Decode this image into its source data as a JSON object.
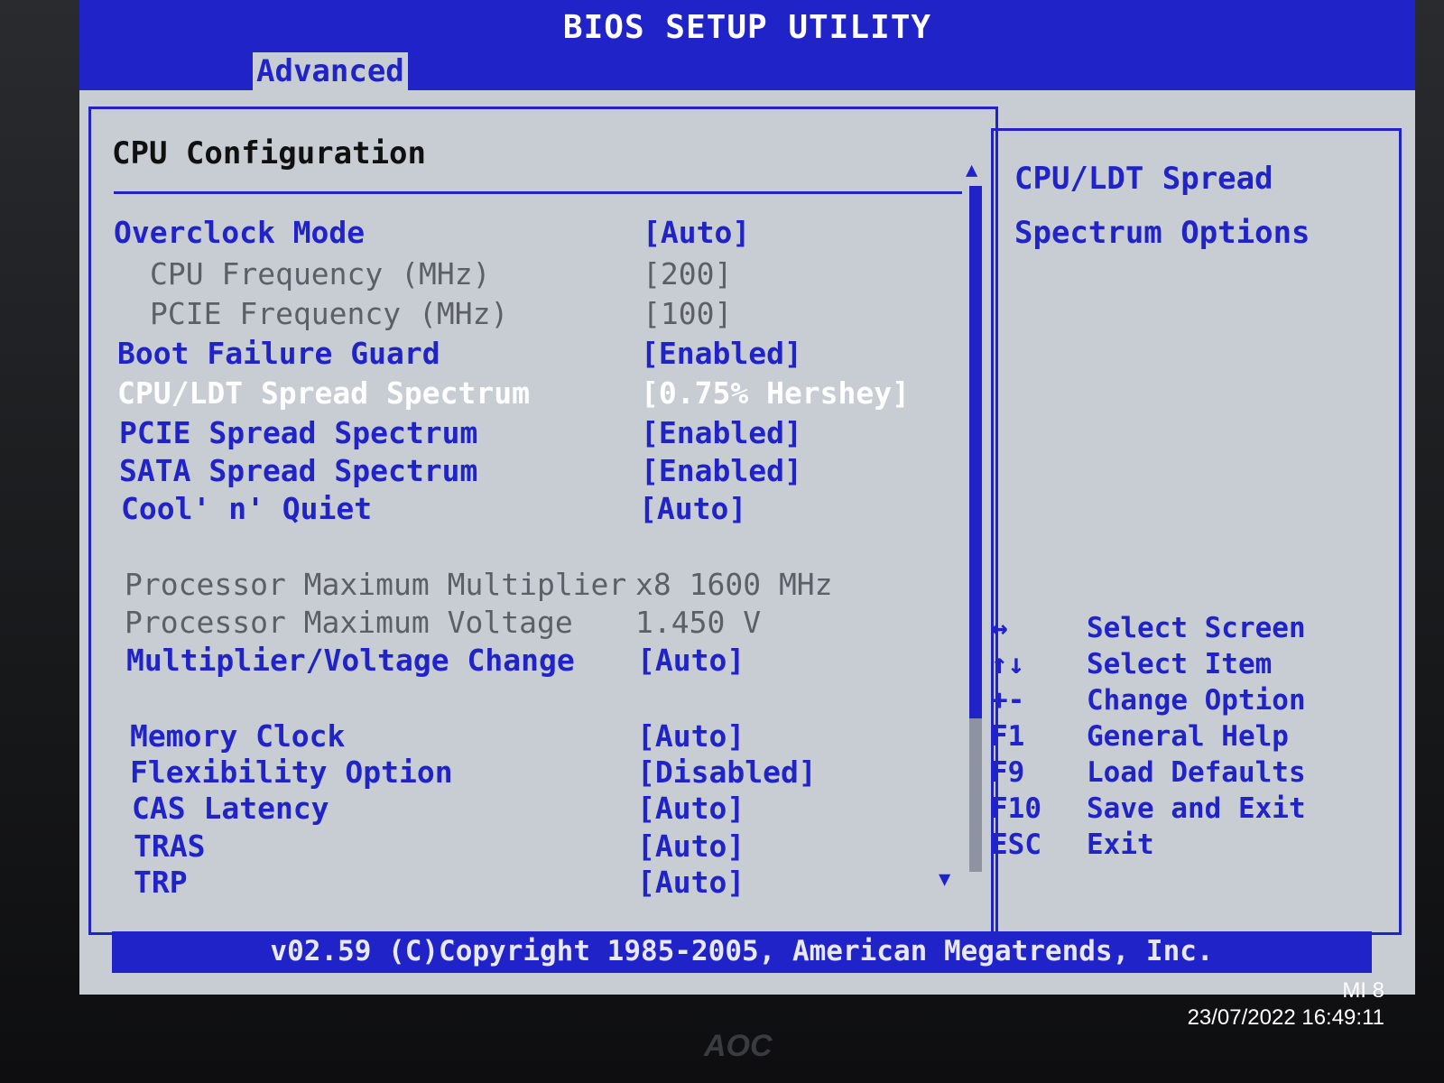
{
  "header": {
    "title": "BIOS SETUP UTILITY",
    "active_tab": "Advanced"
  },
  "main": {
    "section_title": "CPU Configuration",
    "settings": [
      {
        "label": "Overclock Mode",
        "value": "[Auto]",
        "style": "editable"
      },
      {
        "label": "CPU Frequency (MHz)",
        "value": "[200]",
        "style": "disabled"
      },
      {
        "label": "PCIE Frequency (MHz)",
        "value": "[100]",
        "style": "disabled"
      },
      {
        "label": "Boot Failure Guard",
        "value": "[Enabled]",
        "style": "editable"
      },
      {
        "label": "CPU/LDT Spread Spectrum",
        "value": "[0.75% Hershey]",
        "style": "selected"
      },
      {
        "label": "PCIE Spread Spectrum",
        "value": "[Enabled]",
        "style": "editable"
      },
      {
        "label": "SATA Spread Spectrum",
        "value": "[Enabled]",
        "style": "editable"
      },
      {
        "label": "Cool' n' Quiet",
        "value": "[Auto]",
        "style": "editable"
      },
      {
        "label": "Processor Maximum Multiplier",
        "value": "x8  1600 MHz",
        "style": "info"
      },
      {
        "label": "Processor Maximum Voltage",
        "value": "1.450 V",
        "style": "info"
      },
      {
        "label": "Multiplier/Voltage Change",
        "value": "[Auto]",
        "style": "editable"
      },
      {
        "label": "Memory Clock",
        "value": "[Auto]",
        "style": "editable"
      },
      {
        "label": "Flexibility Option",
        "value": "[Disabled]",
        "style": "editable"
      },
      {
        "label": "CAS Latency",
        "value": "[Auto]",
        "style": "editable"
      },
      {
        "label": "TRAS",
        "value": "[Auto]",
        "style": "editable"
      },
      {
        "label": "TRP",
        "value": "[Auto]",
        "style": "editable"
      }
    ],
    "scroll_up_glyph": "▲",
    "scroll_down_glyph": "▼"
  },
  "help": {
    "title": "CPU/LDT Spread Spectrum Options",
    "keys": [
      {
        "key": "↔",
        "action": "Select Screen"
      },
      {
        "key": "↑↓",
        "action": "Select Item"
      },
      {
        "key": "+-",
        "action": "Change Option"
      },
      {
        "key": "F1",
        "action": "General Help"
      },
      {
        "key": "F9",
        "action": "Load Defaults"
      },
      {
        "key": "F10",
        "action": "Save and Exit"
      },
      {
        "key": "ESC",
        "action": "Exit"
      }
    ]
  },
  "footer": {
    "copyright": "v02.59 (C)Copyright 1985-2005, American Megatrends, Inc."
  },
  "photo": {
    "device": "MI 8",
    "timestamp": "23/07/2022 16:49:11",
    "monitor_brand": "AOC"
  },
  "colors": {
    "bios_blue": "#2024c8",
    "bios_grey": "#c8cdd4",
    "highlight": "#ffffff"
  }
}
